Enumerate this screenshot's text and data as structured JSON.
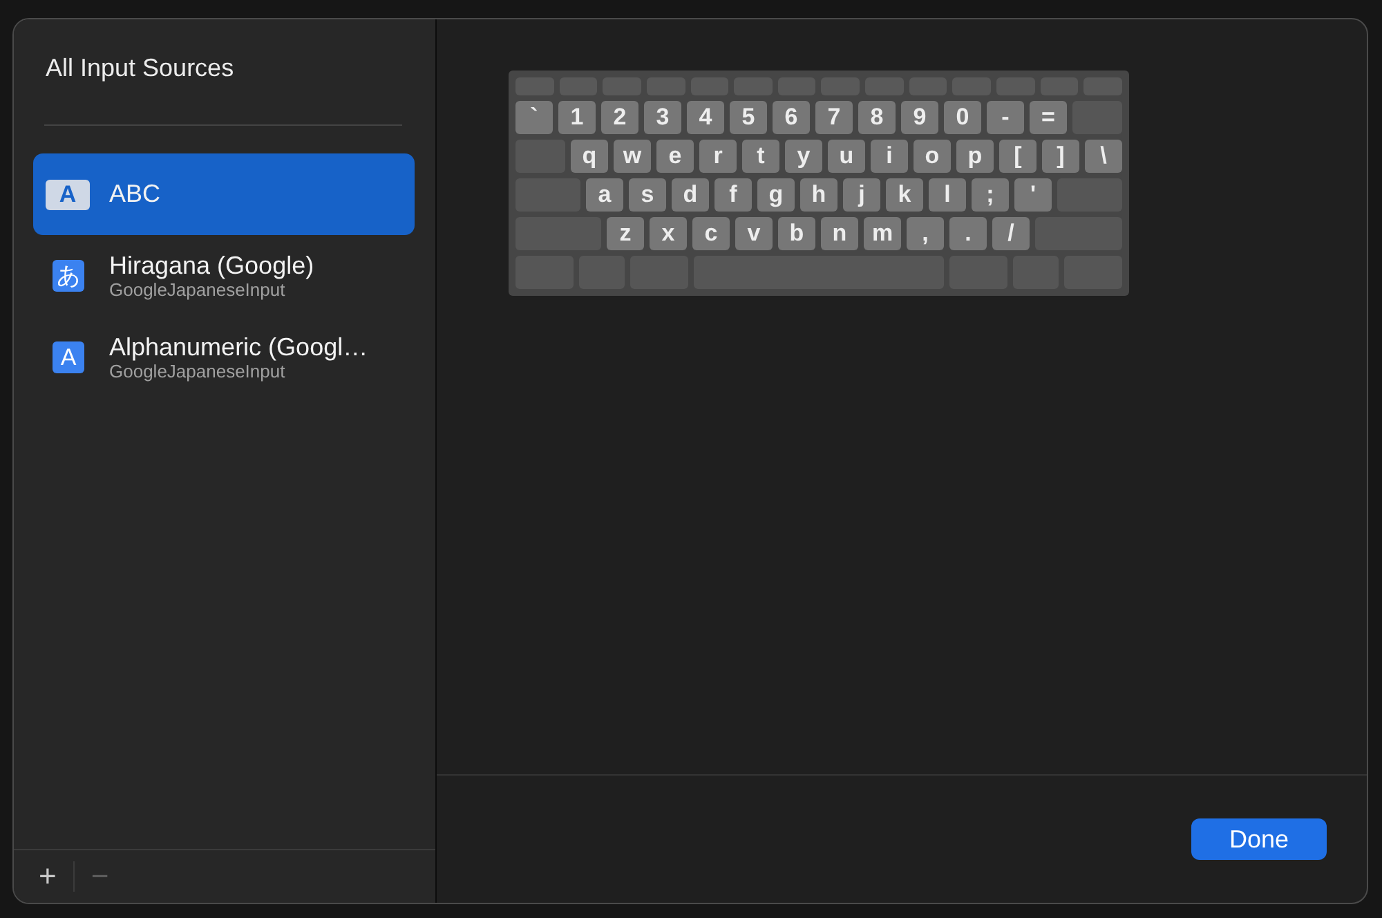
{
  "sidebar": {
    "title": "All Input Sources",
    "items": [
      {
        "name": "ABC",
        "glyph": "A",
        "kind": "keyboard",
        "selected": true
      },
      {
        "name": "Hiragana (Google)",
        "subtitle": "GoogleJapaneseInput",
        "glyph": "あ",
        "kind": "ime",
        "selected": false
      },
      {
        "name": "Alphanumeric (Googl…",
        "subtitle": "GoogleJapaneseInput",
        "glyph": "A",
        "kind": "ime",
        "selected": false
      }
    ],
    "add_button": {
      "label": "+",
      "disabled": false
    },
    "remove_button": {
      "label": "−",
      "disabled": true
    }
  },
  "keyboard": {
    "rows": [
      [
        "`",
        "1",
        "2",
        "3",
        "4",
        "5",
        "6",
        "7",
        "8",
        "9",
        "0",
        "-",
        "="
      ],
      [
        "q",
        "w",
        "e",
        "r",
        "t",
        "y",
        "u",
        "i",
        "o",
        "p",
        "[",
        "]",
        "\\"
      ],
      [
        "a",
        "s",
        "d",
        "f",
        "g",
        "h",
        "j",
        "k",
        "l",
        ";",
        "'"
      ],
      [
        "z",
        "x",
        "c",
        "v",
        "b",
        "n",
        "m",
        ",",
        ".",
        "/"
      ]
    ]
  },
  "done_button": {
    "label": "Done"
  }
}
